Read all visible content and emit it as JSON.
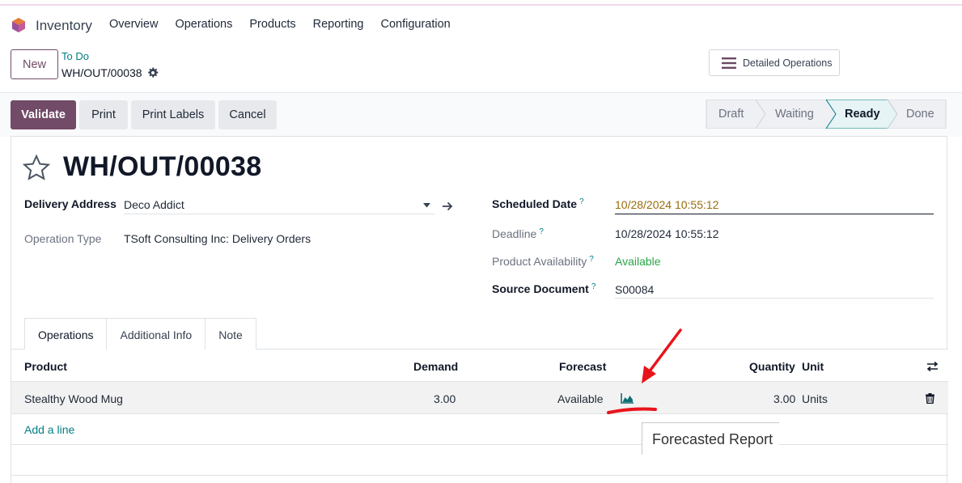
{
  "navbar": {
    "app_name": "Inventory",
    "menu": [
      "Overview",
      "Operations",
      "Products",
      "Reporting",
      "Configuration"
    ]
  },
  "control": {
    "new_label": "New",
    "breadcrumb_parent": "To Do",
    "breadcrumb_current": "WH/OUT/00038",
    "detailed_operations_label": "Detailed Operations"
  },
  "actions": {
    "validate": "Validate",
    "print": "Print",
    "print_labels": "Print Labels",
    "cancel": "Cancel"
  },
  "statusbar": {
    "stages": [
      "Draft",
      "Waiting",
      "Ready",
      "Done"
    ],
    "current": "Ready"
  },
  "record": {
    "title": "WH/OUT/00038",
    "delivery_address_label": "Delivery Address",
    "delivery_address": "Deco Addict",
    "operation_type_label": "Operation Type",
    "operation_type": "TSoft Consulting Inc: Delivery Orders",
    "scheduled_date_label": "Scheduled Date",
    "scheduled_date": "10/28/2024 10:55:12",
    "deadline_label": "Deadline",
    "deadline": "10/28/2024 10:55:12",
    "availability_label": "Product Availability",
    "availability": "Available",
    "source_document_label": "Source Document",
    "source_document": "S00084",
    "help_mark": "?"
  },
  "tabs": [
    "Operations",
    "Additional Info",
    "Note"
  ],
  "table": {
    "headers": {
      "product": "Product",
      "demand": "Demand",
      "forecast": "Forecast",
      "quantity": "Quantity",
      "unit": "Unit"
    },
    "rows": [
      {
        "product": "Stealthy Wood Mug",
        "demand": "3.00",
        "forecast": "Available",
        "quantity": "3.00",
        "unit": "Units"
      }
    ],
    "add_line": "Add a line"
  },
  "tooltip": {
    "text": "Forecasted Report"
  },
  "colors": {
    "brand": "#714b67",
    "link": "#017e84",
    "available": "#28a745",
    "annotation": "#e8141b"
  }
}
